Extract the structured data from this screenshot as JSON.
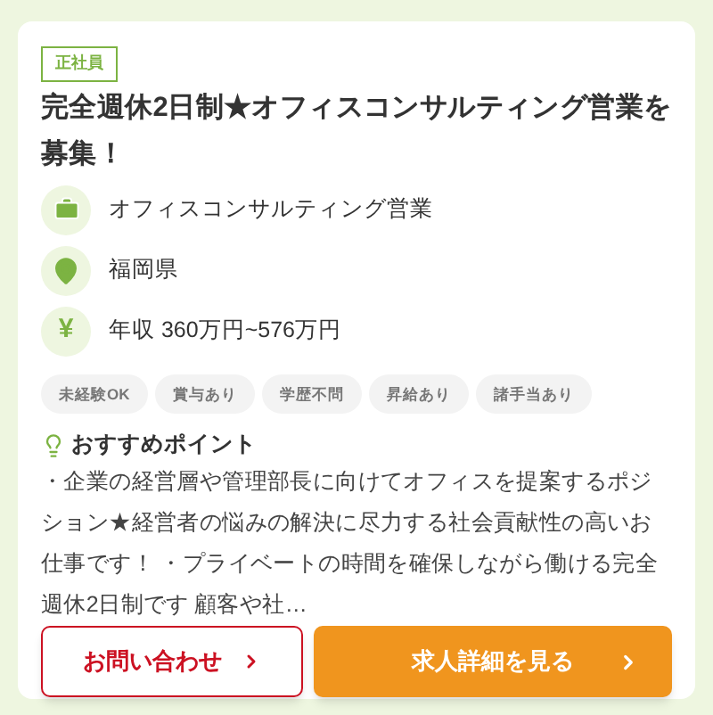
{
  "badge": "正社員",
  "title": "完全週休2日制★オフィスコンサルティング営業を募集！",
  "info": [
    {
      "kind": "job",
      "text": "オフィスコンサルティング営業"
    },
    {
      "kind": "location",
      "text": "福岡県"
    },
    {
      "kind": "salary",
      "icon_text": "¥",
      "text": "年収 360万円~576万円"
    }
  ],
  "tags": [
    "未経験OK",
    "賞与あり",
    "学歴不問",
    "昇給あり",
    "諸手当あり"
  ],
  "point": {
    "heading": "おすすめポイント",
    "body": "・企業の経営層や管理部長に向けてオフィスを提案するポジション★経営者の悩みの解決に尽力する社会貢献性の高いお仕事です！ ・プライベートの時間を確保しながら働ける完全週休2日制です 顧客や社…"
  },
  "buttons": [
    {
      "kind": "outline",
      "label": "お問い合わせ"
    },
    {
      "kind": "primary",
      "label": "求人詳細を見る"
    }
  ]
}
